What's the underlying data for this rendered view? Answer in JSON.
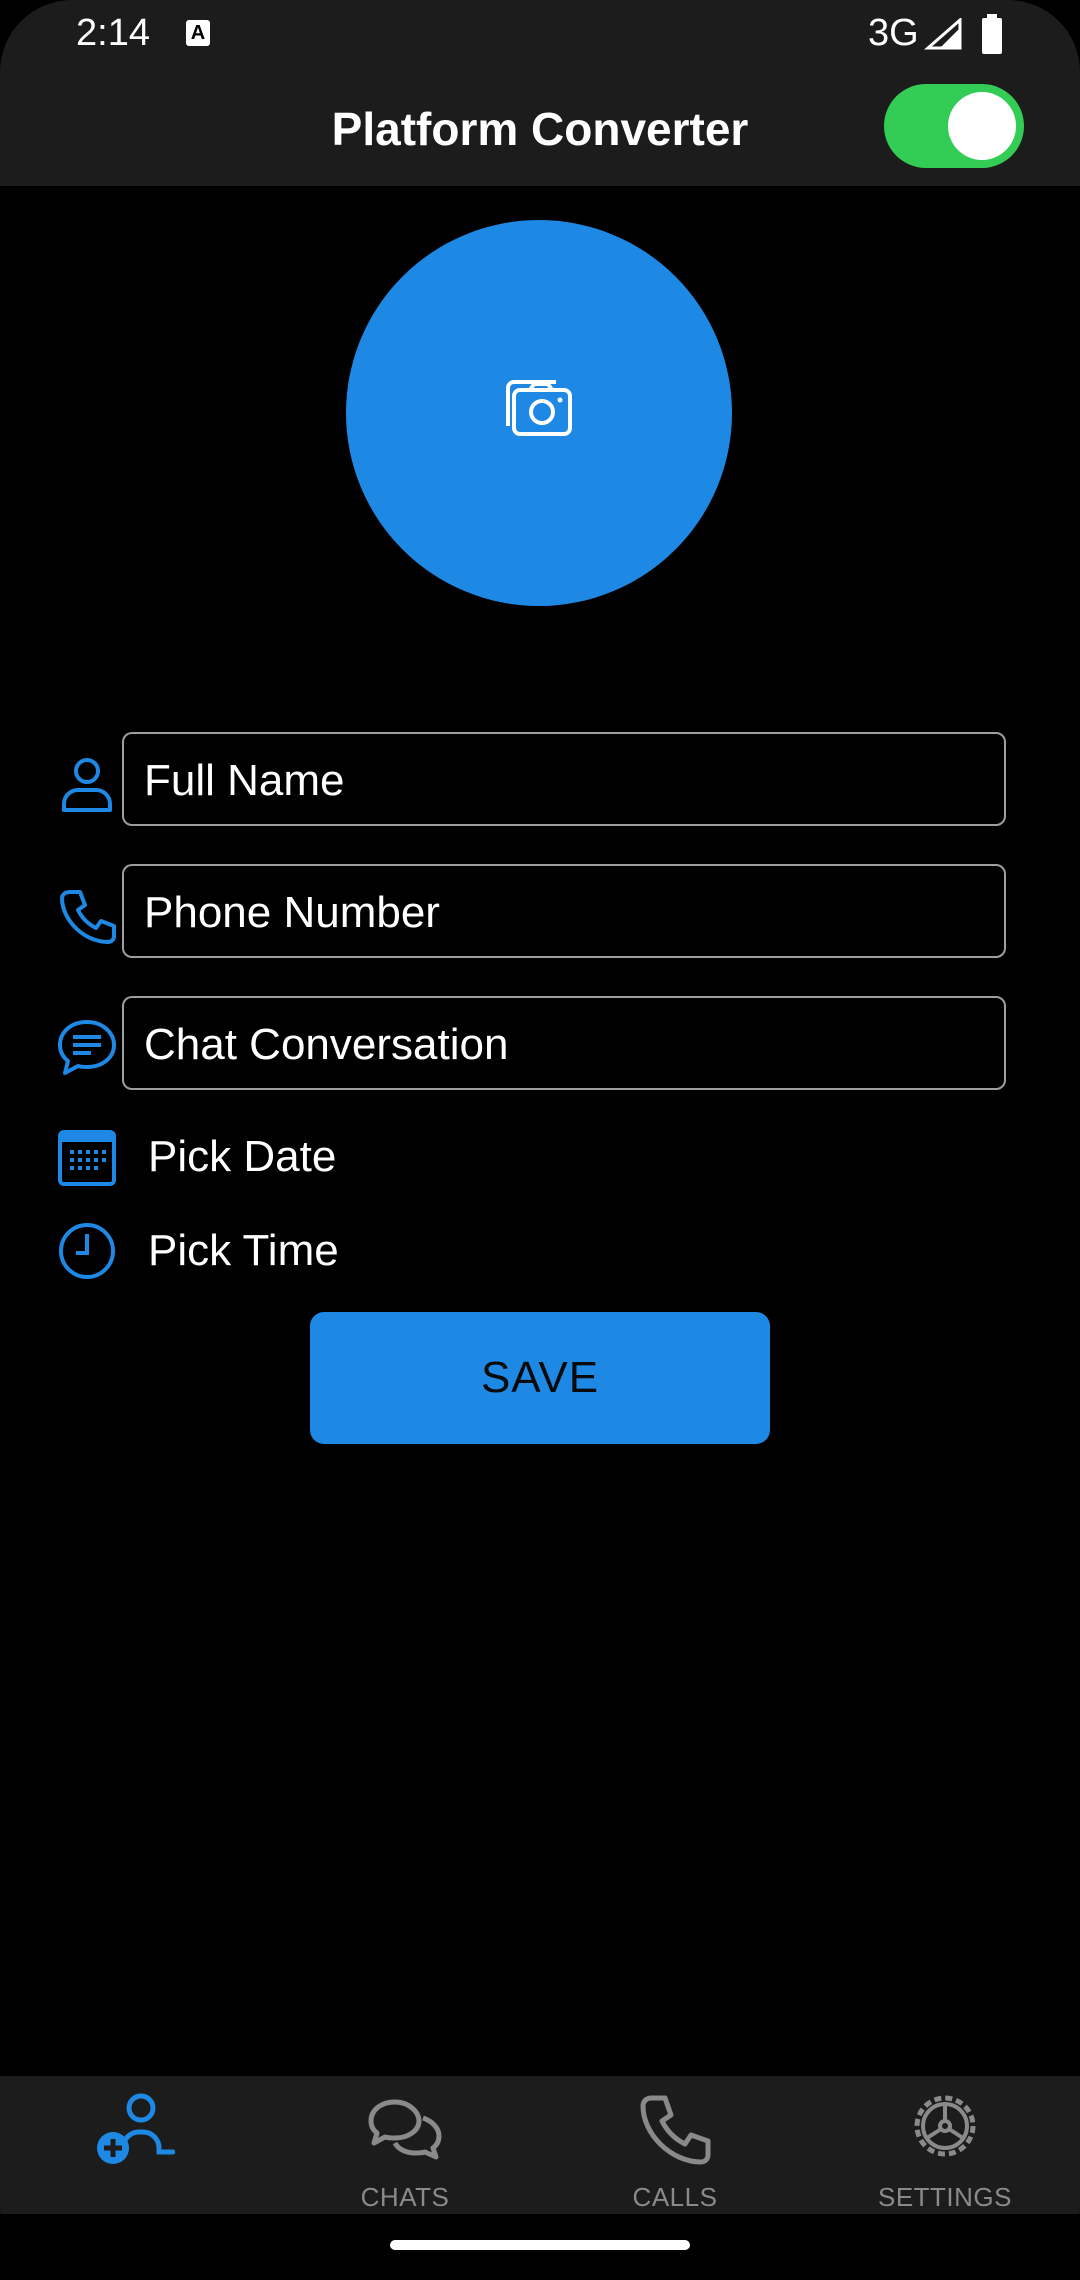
{
  "status_bar": {
    "time": "2:14",
    "notification_icon": "A",
    "network": "3G"
  },
  "app_bar": {
    "title": "Platform Converter",
    "theme_toggle_on": true
  },
  "avatar": {
    "icon": "camera-icon",
    "color": "#1e88e5"
  },
  "form": {
    "full_name_placeholder": "Full Name",
    "phone_placeholder": "Phone Number",
    "chat_placeholder": "Chat Conversation",
    "pick_date_label": "Pick Date",
    "pick_time_label": "Pick Time",
    "save_label": "SAVE"
  },
  "bottom_nav": {
    "items": [
      {
        "label": "",
        "icon": "add-contact-icon",
        "active": true
      },
      {
        "label": "CHATS",
        "icon": "chats-icon",
        "active": false
      },
      {
        "label": "CALLS",
        "icon": "phone-icon",
        "active": false
      },
      {
        "label": "SETTINGS",
        "icon": "settings-icon",
        "active": false
      }
    ]
  },
  "colors": {
    "accent": "#1e88e5",
    "toggle_on": "#33cc55",
    "bar_background": "#1c1c1c",
    "inactive_nav": "#8a8a8a"
  }
}
